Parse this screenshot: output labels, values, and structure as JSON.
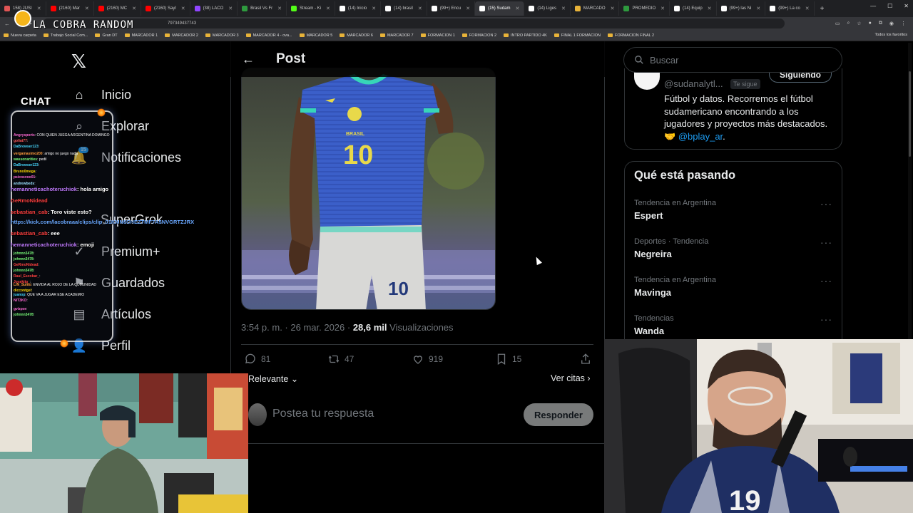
{
  "browser": {
    "tabs": [
      {
        "label": "158) JUSI",
        "color": "#e05555"
      },
      {
        "label": "(2160) Mar",
        "color": "#ff0000"
      },
      {
        "label": "(2160) MC",
        "color": "#ff0000"
      },
      {
        "label": "(2160) Sayl",
        "color": "#ff0000"
      },
      {
        "label": "(38) LACO",
        "color": "#9146ff"
      },
      {
        "label": "Brasil Vs Fr",
        "color": "#2e9a3e"
      },
      {
        "label": "Stream - Ki",
        "color": "#53fc18"
      },
      {
        "label": "(14) Inicio",
        "color": "#ffffff"
      },
      {
        "label": "(14) brasil",
        "color": "#ffffff"
      },
      {
        "label": "(99+) Encu",
        "color": "#ffffff"
      },
      {
        "label": "(15) Sudam",
        "color": "#ffffff"
      },
      {
        "label": "(14) Liges",
        "color": "#ffffff"
      },
      {
        "label": "MARCADO",
        "color": "#e8b339"
      },
      {
        "label": "PROMEDIO",
        "color": "#2e9a3e"
      },
      {
        "label": "(14) Equip",
        "color": "#ffffff"
      },
      {
        "label": "(99+) las Ni",
        "color": "#ffffff"
      },
      {
        "label": "(99+) La co",
        "color": "#ffffff"
      }
    ],
    "active_tab_index": 10,
    "url": "797349437743",
    "bookmarks": [
      "Nueva carpeta",
      "Trabajo Social Com...",
      "Gran DT",
      "MARCADOR 1",
      "MARCADOR 2",
      "MARCADOR 3",
      "MARCADOR 4 - ova...",
      "MARCADOR 5",
      "MARCADOR 6",
      "MARCADOR 7",
      "FORMACION 1",
      "FORMACION 2",
      "INTRO PARTIDO 4K",
      "FINAL 1 FORMACION",
      "FORMACION FINAL 2"
    ],
    "bookmarks_right": "Todos los favoritos"
  },
  "stream": {
    "title": "LA COBRA RANDOM",
    "chat_label": "CHAT",
    "chat_small": [
      {
        "user": "Angrysports",
        "text": ": CON QUIEN JUEGA ARGENTINA DOMINGO",
        "color": "#ff6ad5"
      },
      {
        "user": "goliat77",
        "text": ": ",
        "color": "#ff5959"
      },
      {
        "user": "DaBrowser123",
        "text": ": ",
        "color": "#46d9ff"
      },
      {
        "user": "vergamasimo200",
        "text": ": amigo no juego nada",
        "color": "#ff9c3b"
      },
      {
        "user": "wassonarities",
        "text": ": pedil",
        "color": "#7aff7a"
      },
      {
        "user": "DaBrowser123",
        "text": ": ",
        "color": "#46d9ff"
      },
      {
        "user": "Bruno0mega",
        "text": ":",
        "color": "#ffd700"
      },
      {
        "user": "psicosvoo01",
        "text": ": ",
        "color": "#ff6ad5"
      },
      {
        "user": "andrewbeds",
        "text": ": ",
        "color": "#9be0ff"
      }
    ],
    "chat_big": [
      {
        "user": "hemanneticachoteruchiok",
        "text": ": hola amigo",
        "color": "#c07bff"
      },
      {
        "user": "GeRmoNidead",
        "text": "",
        "color": "#ff4040"
      },
      {
        "user": "sebastian_cab",
        "text": ": Toro viste esto?",
        "color": "#ff4040"
      },
      {
        "user": "https://kick.com/lacobraaa/clips/clip_01KMN6CHEZTMF7A5NVGRTZJRX",
        "text": "",
        "color": "#6aa8ff"
      },
      {
        "user": "sebastian_cab",
        "text": ": eee",
        "color": "#ff4040"
      },
      {
        "user": "hemanneticachoteruchiok",
        "text": ": emoji",
        "color": "#c07bff"
      }
    ],
    "chat_tail": [
      {
        "user": "johnnn3478",
        "text": ": ",
        "color": "#7aff7a"
      },
      {
        "user": "johnnn3478",
        "text": ": ",
        "color": "#7aff7a"
      },
      {
        "user": "GeRmoNidead",
        "text": ": ",
        "color": "#ff4040"
      },
      {
        "user": "johnnn3478",
        "text": ": ",
        "color": "#7aff7a"
      },
      {
        "user": "Raul_Escobar_",
        "text": ": ",
        "color": "#ff4040"
      },
      {
        "user": "Josekito_",
        "text": ": ",
        "color": "#ff4040"
      },
      {
        "user": "LIN_Sulito",
        "text": ": ENVIDA AL ROJO DE LA COMUNIDAD",
        "color": "#ff9c3b"
      },
      {
        "user": "diccontgel",
        "text": ": ",
        "color": "#ffd700"
      },
      {
        "user": "juanop",
        "text": ": QUE VA A JUGAR ESE ACADEMIO",
        "color": "#46d9ff"
      },
      {
        "user": "NIT3KO",
        "text": ": ",
        "color": "#ff6ad5"
      },
      {
        "user": "gvizpor",
        "text": ": ",
        "color": "#ff6ad5"
      },
      {
        "user": "johnnn3478",
        "text": ": ",
        "color": "#7aff7a"
      }
    ]
  },
  "x": {
    "nav": [
      {
        "label": "Inicio",
        "icon": "home-icon"
      },
      {
        "label": "Explorar",
        "icon": "search-icon"
      },
      {
        "label": "Notificaciones",
        "icon": "bell-icon"
      },
      {
        "label": "Grok",
        "icon": "grok-icon",
        "prefix": "Super"
      },
      {
        "label": "Premium+",
        "icon": "premium-icon"
      },
      {
        "label": "Guardados",
        "icon": "bookmark-icon"
      },
      {
        "label": "Artículos",
        "icon": "article-icon"
      },
      {
        "label": "Perfil",
        "icon": "person-icon"
      }
    ],
    "notif_count": "15",
    "post_header": "Post",
    "post": {
      "time": "3:54 p. m.",
      "date": "26 mar. 2026",
      "views": "28,6 mil",
      "views_label": "Visualizaciones",
      "replies": "81",
      "reposts": "47",
      "likes": "919",
      "bookmarks": "15",
      "shirt_text": "BRASIL",
      "number": "10"
    },
    "sort_label": "Relevante",
    "quotes_label": "Ver citas",
    "reply_placeholder": "Postea tu respuesta",
    "reply_button": "Responder",
    "search_placeholder": "Buscar",
    "profile": {
      "handle": "@sudanalytl...",
      "follows_you": "Te sigue",
      "follow_btn": "Siguiendo",
      "bio": "Fútbol y datos. Recorremos el fútbol sudamericano encontrando a los jugadores y proyectos más destacados. 🤝",
      "bio_mention": "@bplay_ar",
      "bio_end": "."
    },
    "trends_title": "Qué está pasando",
    "trends": [
      {
        "meta": "Tendencia en Argentina",
        "name": "Espert"
      },
      {
        "meta": "Deportes · Tendencia",
        "name": "Negreira"
      },
      {
        "meta": "Tendencia en Argentina",
        "name": "Mavinga"
      },
      {
        "meta": "Tendencias",
        "name": "Wanda"
      }
    ]
  },
  "colors": {
    "accent": "#1d9bf0",
    "muted": "#71767b",
    "border": "#2f3336",
    "jersey": "#3b5fc9",
    "jersey_trim": "#37d6b8"
  },
  "webcam_right": {
    "jersey_number": "19"
  }
}
